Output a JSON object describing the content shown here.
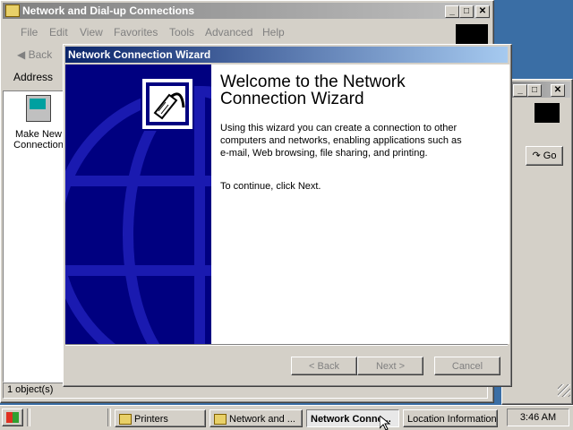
{
  "bg_window": {
    "title": "Network and Dial-up Connections",
    "menu": [
      "File",
      "Edit",
      "View",
      "Favorites",
      "Tools",
      "Advanced",
      "Help"
    ],
    "back_label": "Back",
    "address_label": "Address",
    "icon_label_line1": "Make New",
    "icon_label_line2": "Connection",
    "status": "1 object(s)",
    "go_label": "Go"
  },
  "wizard": {
    "title": "Network Connection Wizard",
    "heading": "Welcome to the Network Connection Wizard",
    "body": "Using this wizard you can create a connection to other computers and networks, enabling applications such as e-mail, Web browsing, file sharing, and printing.",
    "continue_text": "To continue, click Next.",
    "back_button": "< Back",
    "next_button": "Next >",
    "cancel_button": "Cancel"
  },
  "taskbar": {
    "items": [
      "Printers",
      "Network and ...",
      "Network Conne...",
      "Location Information"
    ],
    "clock": "3:46 AM"
  },
  "colors": {
    "desktop": "#3a6ea5",
    "active_title": "#0a246a",
    "wizard_panel": "#000080"
  }
}
